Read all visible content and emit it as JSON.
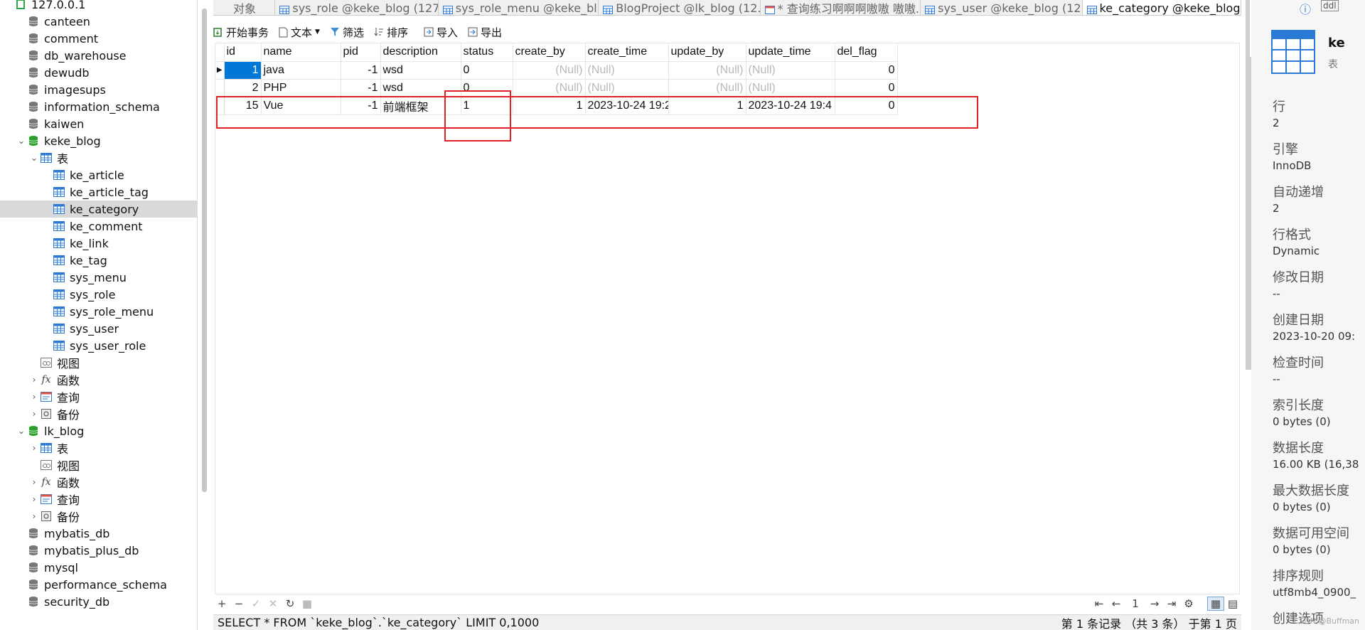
{
  "tree": [
    {
      "label": "127.0.0.1",
      "level": 0,
      "expand": "",
      "icon": "server-icon"
    },
    {
      "label": "canteen",
      "level": 1,
      "expand": "",
      "icon": "database-icon"
    },
    {
      "label": "comment",
      "level": 1,
      "expand": "",
      "icon": "database-icon"
    },
    {
      "label": "db_warehouse",
      "level": 1,
      "expand": "",
      "icon": "database-icon"
    },
    {
      "label": "dewudb",
      "level": 1,
      "expand": "",
      "icon": "database-icon"
    },
    {
      "label": "imagesups",
      "level": 1,
      "expand": "",
      "icon": "database-icon"
    },
    {
      "label": "information_schema",
      "level": 1,
      "expand": "",
      "icon": "database-icon"
    },
    {
      "label": "kaiwen",
      "level": 1,
      "expand": "",
      "icon": "database-icon"
    },
    {
      "label": "keke_blog",
      "level": 1,
      "expand": "v",
      "icon": "database-open-icon"
    },
    {
      "label": "表",
      "level": 2,
      "expand": "v",
      "icon": "table-folder-icon"
    },
    {
      "label": "ke_article",
      "level": 3,
      "expand": "",
      "icon": "table-icon"
    },
    {
      "label": "ke_article_tag",
      "level": 3,
      "expand": "",
      "icon": "table-icon"
    },
    {
      "label": "ke_category",
      "level": 3,
      "expand": "",
      "icon": "table-icon",
      "selected": true
    },
    {
      "label": "ke_comment",
      "level": 3,
      "expand": "",
      "icon": "table-icon"
    },
    {
      "label": "ke_link",
      "level": 3,
      "expand": "",
      "icon": "table-icon"
    },
    {
      "label": "ke_tag",
      "level": 3,
      "expand": "",
      "icon": "table-icon"
    },
    {
      "label": "sys_menu",
      "level": 3,
      "expand": "",
      "icon": "table-icon"
    },
    {
      "label": "sys_role",
      "level": 3,
      "expand": "",
      "icon": "table-icon"
    },
    {
      "label": "sys_role_menu",
      "level": 3,
      "expand": "",
      "icon": "table-icon"
    },
    {
      "label": "sys_user",
      "level": 3,
      "expand": "",
      "icon": "table-icon"
    },
    {
      "label": "sys_user_role",
      "level": 3,
      "expand": "",
      "icon": "table-icon"
    },
    {
      "label": "视图",
      "level": 2,
      "expand": "",
      "icon": "view-icon"
    },
    {
      "label": "函数",
      "level": 2,
      "expand": ">",
      "icon": "function-icon"
    },
    {
      "label": "查询",
      "level": 2,
      "expand": ">",
      "icon": "query-icon"
    },
    {
      "label": "备份",
      "level": 2,
      "expand": ">",
      "icon": "backup-icon"
    },
    {
      "label": "lk_blog",
      "level": 1,
      "expand": "v",
      "icon": "database-open-icon"
    },
    {
      "label": "表",
      "level": 2,
      "expand": ">",
      "icon": "table-folder-icon"
    },
    {
      "label": "视图",
      "level": 2,
      "expand": "",
      "icon": "view-icon"
    },
    {
      "label": "函数",
      "level": 2,
      "expand": ">",
      "icon": "function-icon"
    },
    {
      "label": "查询",
      "level": 2,
      "expand": ">",
      "icon": "query-icon"
    },
    {
      "label": "备份",
      "level": 2,
      "expand": ">",
      "icon": "backup-icon"
    },
    {
      "label": "mybatis_db",
      "level": 1,
      "expand": "",
      "icon": "database-icon"
    },
    {
      "label": "mybatis_plus_db",
      "level": 1,
      "expand": "",
      "icon": "database-icon"
    },
    {
      "label": "mysql",
      "level": 1,
      "expand": "",
      "icon": "database-icon"
    },
    {
      "label": "performance_schema",
      "level": 1,
      "expand": "",
      "icon": "database-icon"
    },
    {
      "label": "security_db",
      "level": 1,
      "expand": "",
      "icon": "database-icon"
    }
  ],
  "tabs": [
    {
      "label": "对象",
      "icon": ""
    },
    {
      "label": "sys_role @keke_blog (127...",
      "icon": "table"
    },
    {
      "label": "sys_role_menu @keke_bl...",
      "icon": "table"
    },
    {
      "label": "BlogProject @lk_blog (12...",
      "icon": "table"
    },
    {
      "label": "* 查询练习啊啊啊嗷嗷 嗷嗷...",
      "icon": "query"
    },
    {
      "label": "sys_user @keke_blog (12...",
      "icon": "table"
    },
    {
      "label": "ke_category @keke_blog ...",
      "icon": "table",
      "active": true
    }
  ],
  "toolbar": {
    "begin_tx": "开始事务",
    "text": "文本",
    "filter": "筛选",
    "sort": "排序",
    "import": "导入",
    "export": "导出"
  },
  "columns": [
    "id",
    "name",
    "pid",
    "description",
    "status",
    "create_by",
    "create_time",
    "update_by",
    "update_time",
    "del_flag"
  ],
  "rows": [
    [
      "1",
      "java",
      "-1",
      "wsd",
      "0",
      "(Null)",
      "(Null)",
      "(Null)",
      "(Null)",
      "0"
    ],
    [
      "2",
      "PHP",
      "-1",
      "wsd",
      "0",
      "(Null)",
      "(Null)",
      "(Null)",
      "(Null)",
      "0"
    ],
    [
      "15",
      "Vue",
      "-1",
      "前端框架",
      "1",
      "1",
      "2023-10-24 19:2",
      "1",
      "2023-10-24 19:4",
      "0"
    ]
  ],
  "pager": {
    "page": "1"
  },
  "status": {
    "sql": "SELECT * FROM `keke_blog`.`ke_category` LIMIT 0,1000",
    "info": "第 1 条记录 （共 3 条） 于第 1 页"
  },
  "info_panel": {
    "name": "ke",
    "type": "表",
    "props": [
      {
        "k": "行",
        "v": "2"
      },
      {
        "k": "引擎",
        "v": "InnoDB"
      },
      {
        "k": "自动递增",
        "v": "2"
      },
      {
        "k": "行格式",
        "v": "Dynamic"
      },
      {
        "k": "修改日期",
        "v": "--"
      },
      {
        "k": "创建日期",
        "v": "2023-10-20 09:"
      },
      {
        "k": "检查时间",
        "v": "--"
      },
      {
        "k": "索引长度",
        "v": "0 bytes (0)"
      },
      {
        "k": "数据长度",
        "v": "16.00 KB (16,38"
      },
      {
        "k": "最大数据长度",
        "v": "0 bytes (0)"
      },
      {
        "k": "数据可用空间",
        "v": "0 bytes (0)"
      },
      {
        "k": "排序规则",
        "v": "utf8mb4_0900_"
      },
      {
        "k": "创建选项",
        "v": ""
      }
    ]
  },
  "watermark": "CSDN @Buffman"
}
